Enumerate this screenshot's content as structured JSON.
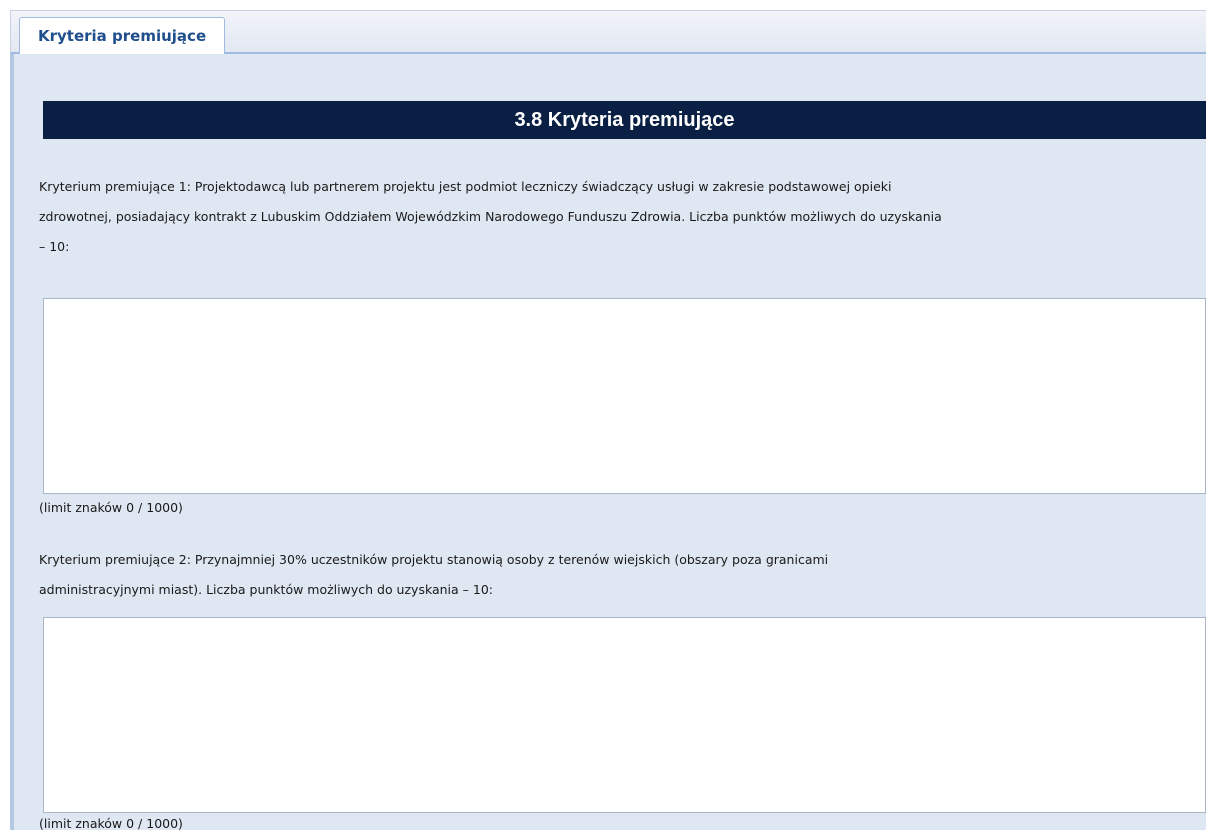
{
  "tabs": [
    {
      "label": "Kryteria premiujące"
    }
  ],
  "section": {
    "title": "3.8 Kryteria premiujące"
  },
  "criteria": [
    {
      "label_line1": "Kryterium premiujące 1: Projektodawcą lub partnerem projektu jest podmiot leczniczy świadczący usługi w zakresie podstawowej opieki",
      "label_line2": "zdrowotnej, posiadający kontrakt z Lubuskim Oddziałem Wojewódzkim Narodowego Funduszu Zdrowia. Liczba punktów możliwych do uzyskania",
      "label_line3": "– 10:",
      "value": "",
      "limit_text": "(limit znaków 0 / 1000)"
    },
    {
      "label_line1": "Kryterium premiujące 2: Przynajmniej 30% uczestników projektu stanowią osoby z terenów wiejskich (obszary poza granicami",
      "label_line2": "administracyjnymi miast). Liczba punktów możliwych do uzyskania – 10:",
      "value": "",
      "limit_text": "(limit znaków 0 / 1000)"
    }
  ]
}
